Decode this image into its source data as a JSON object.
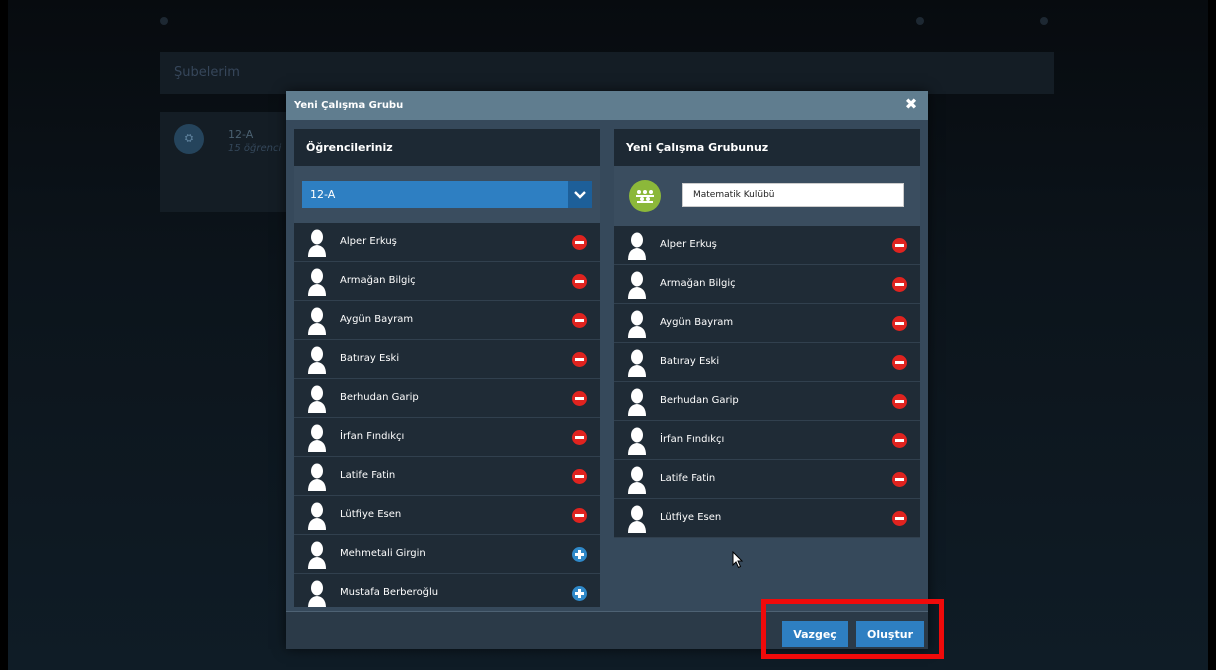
{
  "background": {
    "header_title": "Şubelerim",
    "card_class": "12-A",
    "card_subtitle": "15 öğrenci"
  },
  "modal": {
    "title": "Yeni Çalışma Grubu",
    "close_icon": "close-icon",
    "left_column": {
      "heading": "Öğrencileriniz",
      "selected_class": "12-A",
      "students": [
        {
          "name": "Alper Erkuş",
          "action": "remove"
        },
        {
          "name": "Armağan Bilgiç",
          "action": "remove"
        },
        {
          "name": "Aygün Bayram",
          "action": "remove"
        },
        {
          "name": "Batıray Eski",
          "action": "remove"
        },
        {
          "name": "Berhudan Garip",
          "action": "remove"
        },
        {
          "name": "İrfan Fındıkçı",
          "action": "remove"
        },
        {
          "name": "Latife Fatin",
          "action": "remove"
        },
        {
          "name": "Lütfiye Esen",
          "action": "remove"
        },
        {
          "name": "Mehmetali Girgin",
          "action": "add"
        },
        {
          "name": "Mustafa Berberoğlu",
          "action": "add"
        }
      ]
    },
    "right_column": {
      "heading": "Yeni Çalışma Grubunuz",
      "group_name_value": "Matematik Kulübü",
      "members": [
        {
          "name": "Alper Erkuş"
        },
        {
          "name": "Armağan Bilgiç"
        },
        {
          "name": "Aygün Bayram"
        },
        {
          "name": "Batıray Eski"
        },
        {
          "name": "Berhudan Garip"
        },
        {
          "name": "İrfan Fındıkçı"
        },
        {
          "name": "Latife Fatin"
        },
        {
          "name": "Lütfiye Esen"
        }
      ]
    },
    "footer": {
      "cancel_label": "Vazgeç",
      "create_label": "Oluştur"
    }
  },
  "colors": {
    "accent_blue": "#2e7fc2",
    "remove_red": "#e0231f",
    "group_icon_green": "#8cb83a",
    "highlight_red": "#f00a0a"
  }
}
